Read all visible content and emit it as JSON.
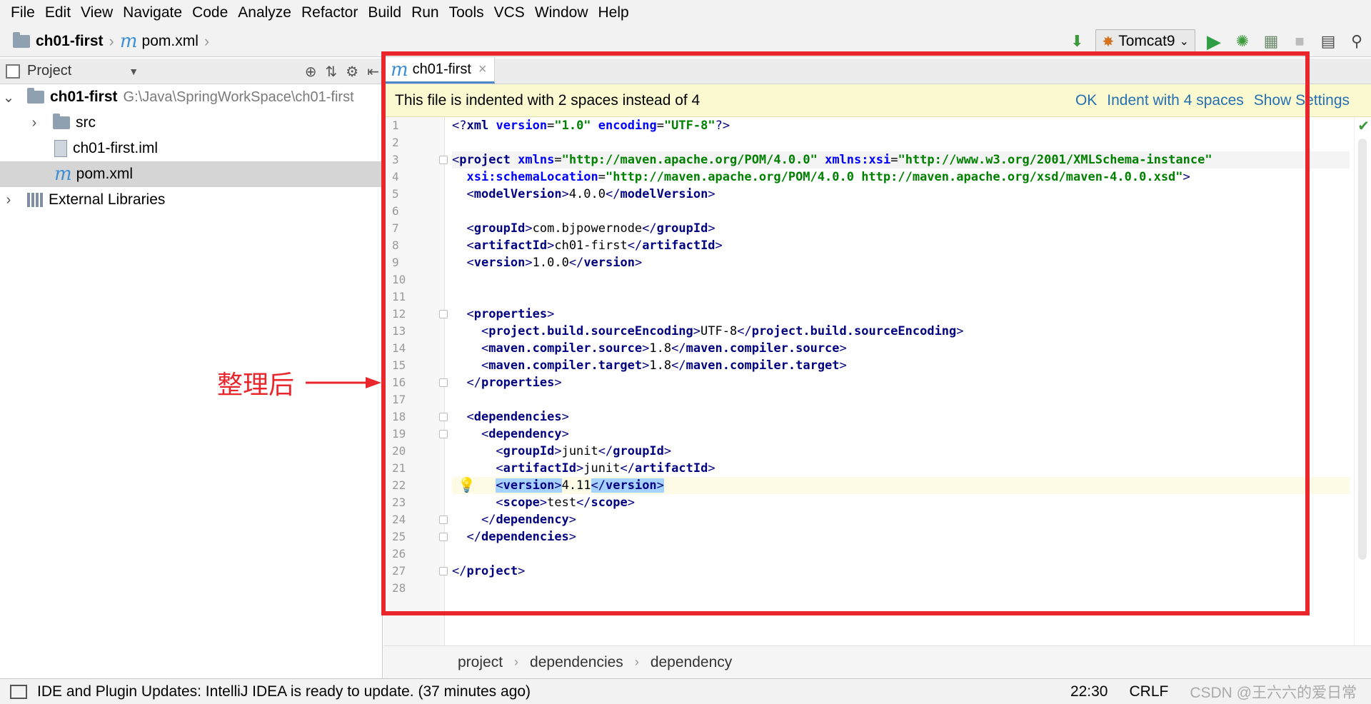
{
  "menu": [
    "File",
    "Edit",
    "View",
    "Navigate",
    "Code",
    "Analyze",
    "Refactor",
    "Build",
    "Run",
    "Tools",
    "VCS",
    "Window",
    "Help"
  ],
  "navbar": {
    "project": "ch01-first",
    "file": "pom.xml",
    "run_config": "Tomcat9"
  },
  "project_panel": {
    "title": "Project",
    "items": [
      {
        "label": "ch01-first",
        "path": "G:\\Java\\SpringWorkSpace\\ch01-first"
      },
      {
        "label": "src"
      },
      {
        "label": "ch01-first.iml"
      },
      {
        "label": "pom.xml"
      },
      {
        "label": "External Libraries"
      }
    ]
  },
  "editor": {
    "tab": "ch01-first",
    "notice": "This file is indented with 2 spaces instead of 4",
    "notice_actions": [
      "OK",
      "Indent with 4 spaces",
      "Show Settings"
    ],
    "line_numbers": [
      "1",
      "2",
      "3",
      "4",
      "5",
      "6",
      "7",
      "8",
      "9",
      "10",
      "11",
      "12",
      "13",
      "14",
      "15",
      "16",
      "17",
      "18",
      "19",
      "20",
      "21",
      "22",
      "23",
      "24",
      "25",
      "26",
      "27",
      "28"
    ],
    "breadcrumb": [
      "project",
      "dependencies",
      "dependency"
    ]
  },
  "code": {
    "decl_a": "version",
    "decl_v": "\"1.0\"",
    "enc_a": "encoding",
    "enc_v": "\"UTF-8\"",
    "xmlns_a": "xmlns",
    "xmlns_v": "\"http://maven.apache.org/POM/4.0.0\"",
    "xsi_a": "xmlns:xsi",
    "xsi_v": "\"http://www.w3.org/2001/XMLSchema-instance\"",
    "schema_a": "xsi:schemaLocation",
    "schema_v": "\"http://maven.apache.org/POM/4.0.0 http://maven.apache.org/xsd/maven-4.0.0.xsd\"",
    "modelVersion": "4.0.0",
    "groupId": "com.bjpowernode",
    "artifactId": "ch01-first",
    "version": "1.0.0",
    "encoding": "UTF-8",
    "source": "1.8",
    "target": "1.8",
    "dep_groupId": "junit",
    "dep_artifactId": "junit",
    "dep_version": "4.11",
    "dep_scope": "test"
  },
  "annotation": "整理后",
  "status": {
    "message": "IDE and Plugin Updates: IntelliJ IDEA is ready to update. (37 minutes ago)",
    "position": "22:30",
    "line_sep": "CRLF",
    "watermark": "CSDN @王六六的爱日常"
  },
  "colors": {
    "annotation_red": "#e8262b",
    "notice_bg": "#fbf9d0",
    "link_blue": "#2470b3",
    "tag_navy": "#000080",
    "value_green": "#008000"
  }
}
